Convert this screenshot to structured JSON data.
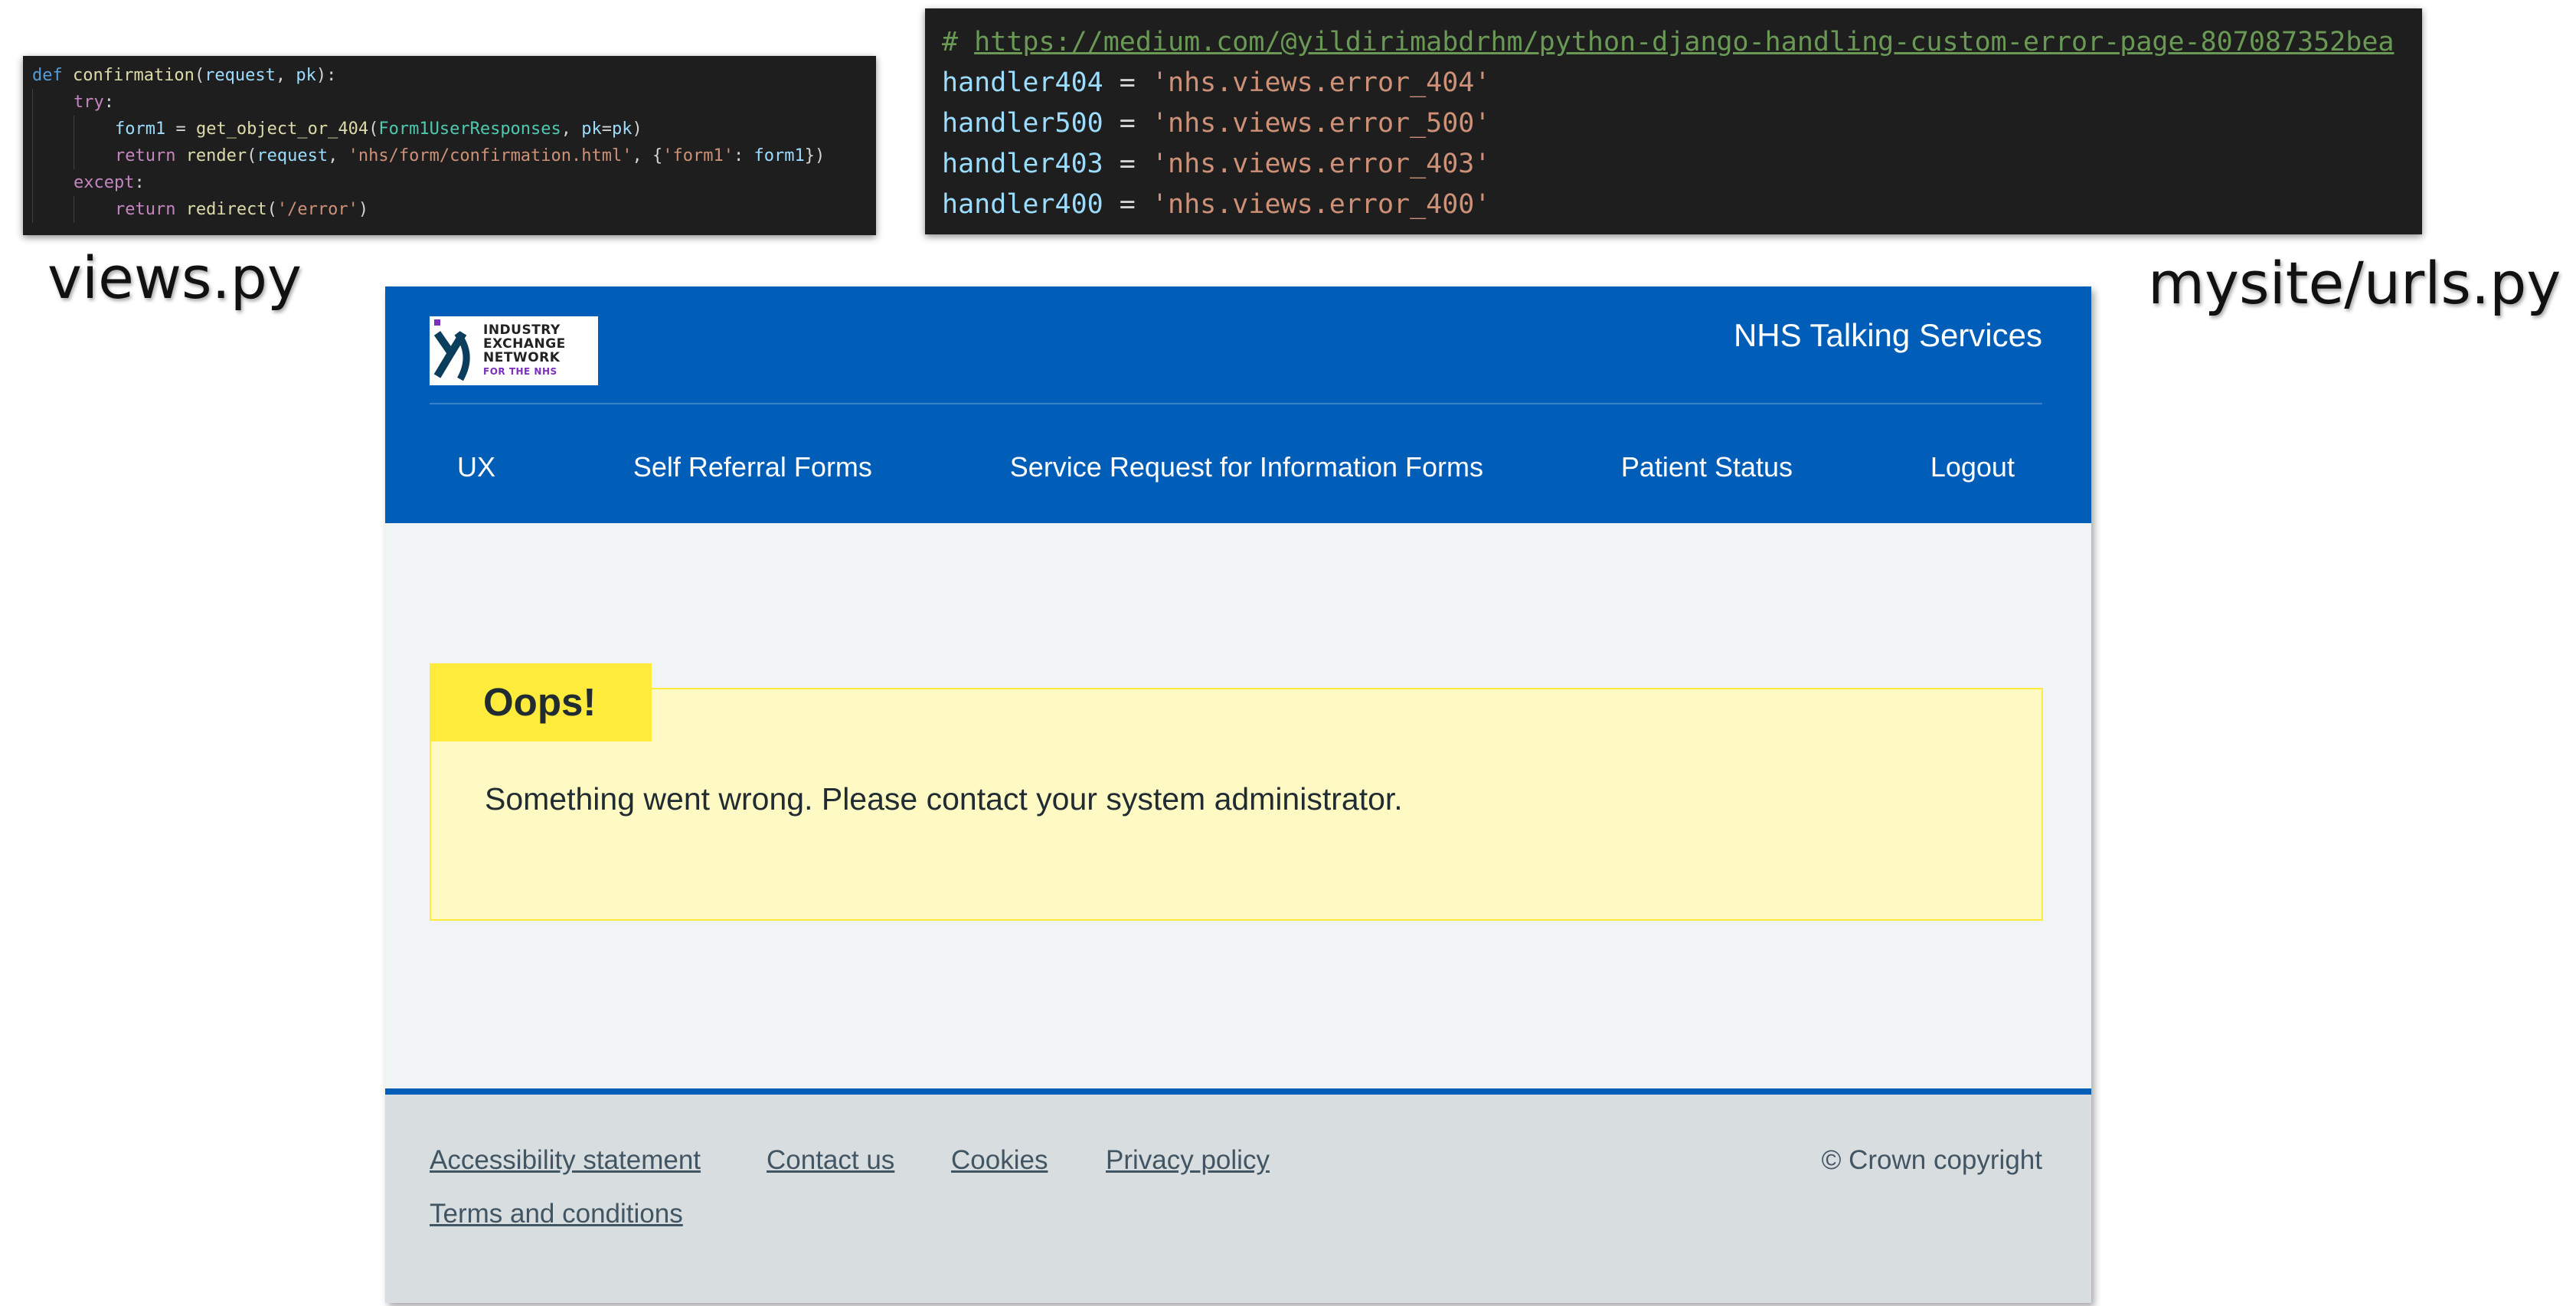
{
  "views_code": {
    "lines": [
      {
        "parts": [
          [
            "kw",
            "def "
          ],
          [
            "fn",
            "confirmation"
          ],
          [
            "pun",
            "("
          ],
          [
            "var",
            "request"
          ],
          [
            "pun",
            ", "
          ],
          [
            "var",
            "pk"
          ],
          [
            "pun",
            "):"
          ]
        ]
      },
      {
        "indent": 1,
        "parts": [
          [
            "ctl",
            "try"
          ],
          [
            "pun",
            ":"
          ]
        ]
      },
      {
        "indent": 2,
        "parts": [
          [
            "var",
            "form1"
          ],
          [
            "pun",
            " = "
          ],
          [
            "fn",
            "get_object_or_404"
          ],
          [
            "pun",
            "("
          ],
          [
            "cls",
            "Form1UserResponses"
          ],
          [
            "pun",
            ", "
          ],
          [
            "var",
            "pk"
          ],
          [
            "pun",
            "="
          ],
          [
            "var",
            "pk"
          ],
          [
            "pun",
            ")"
          ]
        ]
      },
      {
        "indent": 2,
        "parts": [
          [
            "ctl",
            "return "
          ],
          [
            "fn",
            "render"
          ],
          [
            "pun",
            "("
          ],
          [
            "var",
            "request"
          ],
          [
            "pun",
            ", "
          ],
          [
            "str",
            "'nhs/form/confirmation.html'"
          ],
          [
            "pun",
            ", {"
          ],
          [
            "str",
            "'form1'"
          ],
          [
            "pun",
            ": "
          ],
          [
            "var",
            "form1"
          ],
          [
            "pun",
            "})"
          ]
        ]
      },
      {
        "indent": 1,
        "parts": [
          [
            "ctl",
            "except"
          ],
          [
            "pun",
            ":"
          ]
        ]
      },
      {
        "indent": 2,
        "parts": [
          [
            "ctl",
            "return "
          ],
          [
            "fn",
            "redirect"
          ],
          [
            "pun",
            "("
          ],
          [
            "str",
            "'/error'"
          ],
          [
            "pun",
            ")"
          ]
        ]
      }
    ]
  },
  "urls_code": {
    "comment_prefix": "# ",
    "comment_url": "https://medium.com/@yildirimabdrhm/python-django-handling-custom-error-page-807087352bea",
    "handlers": [
      {
        "name": "handler404",
        "value": "'nhs.views.error_404'"
      },
      {
        "name": "handler500",
        "value": "'nhs.views.error_500'"
      },
      {
        "name": "handler403",
        "value": "'nhs.views.error_403'"
      },
      {
        "name": "handler400",
        "value": "'nhs.views.error_400'"
      }
    ]
  },
  "captions": {
    "views": "views.py",
    "urls": "mysite/urls.py"
  },
  "header": {
    "logo_lines": [
      "INDUSTRY",
      "EXCHANGE",
      "NETWORK"
    ],
    "logo_sub": "FOR THE NHS",
    "service_name": "NHS Talking Services",
    "nav": [
      "UX",
      "Self Referral Forms",
      "Service Request for Information Forms",
      "Patient Status",
      "Logout"
    ]
  },
  "error_panel": {
    "label": "Oops!",
    "message": "Something went wrong. Please contact your system administrator."
  },
  "footer": {
    "links": [
      "Accessibility statement",
      "Contact us",
      "Cookies",
      "Privacy policy",
      "Terms and conditions"
    ],
    "copyright": "© Crown copyright"
  },
  "colors": {
    "nhs_blue": "#005eb8",
    "panel_yellow": "#fff9c4",
    "label_yellow": "#ffeb3b"
  }
}
